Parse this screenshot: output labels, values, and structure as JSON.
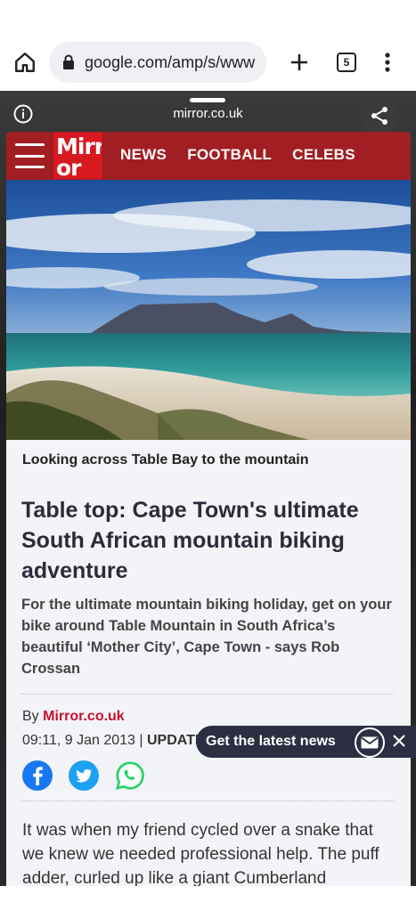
{
  "browser": {
    "url": "google.com/amp/s/www",
    "tab_count": "5",
    "icons": [
      "home-icon",
      "lock-icon",
      "plus-icon",
      "tabs-icon",
      "overflow-menu-icon"
    ]
  },
  "amp_viewer": {
    "domain": "mirror.co.uk",
    "icons": [
      "info-icon",
      "close-icon",
      "share-icon"
    ]
  },
  "site": {
    "logo_text": "Mirror",
    "nav": [
      "NEWS",
      "FOOTBALL",
      "CELEBS"
    ],
    "colors": {
      "brand_red": "#a11e22",
      "logo_red": "#d71920",
      "link_red": "#c8102e"
    }
  },
  "article": {
    "image_caption": "Looking across Table Bay to the mountain",
    "headline": "Table top: Cape Town's ultimate South African mountain biking adventure",
    "standfirst": "For the ultimate mountain biking holiday, get on your bike around Table Mountain in South Africa’s beautiful ‘Mother City’, Cape Town - says Rob Crossan",
    "byline_prefix": "By",
    "byline_source": "Mirror.co.uk",
    "timestamp": "09:11, 9 Jan 2013",
    "timestamp_sep": "|",
    "updated_label": "UPDATED",
    "body": "It was when my friend cycled over a snake that we knew we needed professional help. The puff adder, curled up like a giant Cumberland"
  },
  "social": [
    "facebook-icon",
    "twitter-icon",
    "whatsapp-icon"
  ],
  "newsletter_banner": {
    "label": "Get the latest news"
  }
}
